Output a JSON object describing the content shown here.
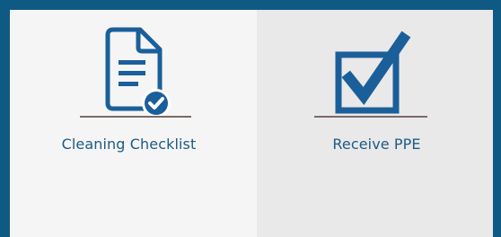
{
  "tiles": [
    {
      "label": "Cleaning Checklist",
      "icon": "document-check-icon"
    },
    {
      "label": "Receive PPE",
      "icon": "checkbox-checked-icon"
    }
  ],
  "colors": {
    "frame": "#0f5a84",
    "icon": "#1b5f9a",
    "label": "#1d5a86",
    "tile_left_bg": "#f5f5f5",
    "tile_right_bg": "#e9e9e9",
    "divider": "#7b6a68"
  }
}
